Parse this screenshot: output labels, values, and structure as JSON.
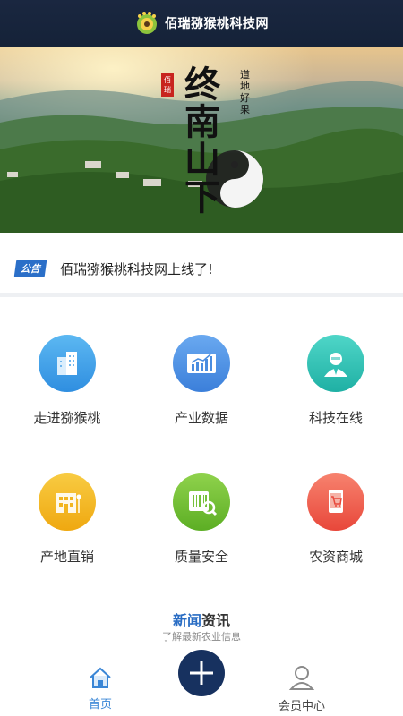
{
  "header": {
    "title": "佰瑞猕猴桃科技网"
  },
  "banner": {
    "seal_text": "佰瑞",
    "calligraphy": "终南山下",
    "side_text": "道地好果",
    "slides_count": 4,
    "active_slide": 2
  },
  "notice": {
    "badge": "公告",
    "text": "佰瑞猕猴桃科技网上线了!"
  },
  "menu": [
    {
      "label": "走进猕猴桃",
      "icon": "building-icon",
      "color": "#3fa2e8"
    },
    {
      "label": "产业数据",
      "icon": "bar-chart-icon",
      "color": "#4a8de0"
    },
    {
      "label": "科技在线",
      "icon": "expert-icon",
      "color": "#2fc2b6"
    },
    {
      "label": "产地直销",
      "icon": "store-icon",
      "color": "#f2b51f"
    },
    {
      "label": "质量安全",
      "icon": "barcode-scan-icon",
      "color": "#76c13a"
    },
    {
      "label": "农资商城",
      "icon": "shopping-cart-icon",
      "color": "#f0604e"
    }
  ],
  "news": {
    "title_a": "新闻",
    "title_b": "资讯",
    "subtitle": "了解最新农业信息"
  },
  "bottom_nav": {
    "home": "首页",
    "member": "会员中心"
  },
  "colors": {
    "header_bg": "#152238",
    "accent": "#2b6fc8",
    "plus_bg": "#17315f"
  }
}
